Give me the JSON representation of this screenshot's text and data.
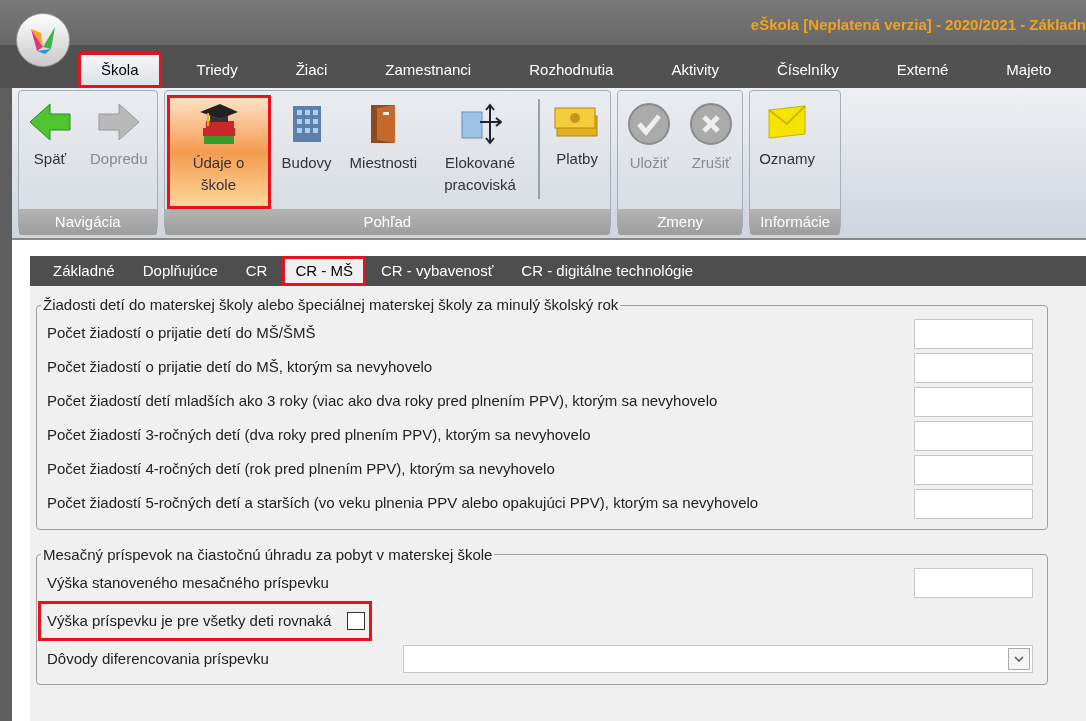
{
  "window": {
    "title": "eŠkola [Neplatená verzia] - 2020/2021 - Základn"
  },
  "menu_tabs": [
    {
      "label": "Škola",
      "selected": true,
      "highlighted": true
    },
    {
      "label": "Triedy",
      "selected": false,
      "highlighted": false
    },
    {
      "label": "Žiaci",
      "selected": false,
      "highlighted": false
    },
    {
      "label": "Zamestnanci",
      "selected": false,
      "highlighted": false
    },
    {
      "label": "Rozhodnutia",
      "selected": false,
      "highlighted": false
    },
    {
      "label": "Aktivity",
      "selected": false,
      "highlighted": false
    },
    {
      "label": "Číselníky",
      "selected": false,
      "highlighted": false
    },
    {
      "label": "Externé",
      "selected": false,
      "highlighted": false
    },
    {
      "label": "Majeto",
      "selected": false,
      "highlighted": false
    }
  ],
  "ribbon_groups": [
    {
      "label": "Navigácia",
      "buttons": [
        {
          "kind": "back",
          "label": "Späť",
          "disabled": false,
          "selected": false,
          "highlighted": false,
          "separator_before": false
        },
        {
          "kind": "forward",
          "label": "Dopredu",
          "disabled": true,
          "selected": false,
          "highlighted": false,
          "separator_before": false
        }
      ]
    },
    {
      "label": "Pohľad",
      "buttons": [
        {
          "kind": "school",
          "label": "Údaje o škole",
          "disabled": false,
          "selected": true,
          "highlighted": true,
          "separator_before": false
        },
        {
          "kind": "building",
          "label": "Budovy",
          "disabled": false,
          "selected": false,
          "highlighted": false,
          "separator_before": false
        },
        {
          "kind": "door",
          "label": "Miestnosti",
          "disabled": false,
          "selected": false,
          "highlighted": false,
          "separator_before": false
        },
        {
          "kind": "branch",
          "label": "Elokované pracoviská",
          "disabled": false,
          "selected": false,
          "highlighted": false,
          "separator_before": false
        },
        {
          "kind": "money",
          "label": "Platby",
          "disabled": false,
          "selected": false,
          "highlighted": false,
          "separator_before": true
        }
      ]
    },
    {
      "label": "Zmeny",
      "buttons": [
        {
          "kind": "save",
          "label": "Uložiť",
          "disabled": true,
          "selected": false,
          "highlighted": false,
          "separator_before": false
        },
        {
          "kind": "cancel",
          "label": "Zrušiť",
          "disabled": true,
          "selected": false,
          "highlighted": false,
          "separator_before": false
        }
      ]
    },
    {
      "label": "Informácie",
      "buttons": [
        {
          "kind": "mail",
          "label": "Oznamy",
          "disabled": false,
          "selected": false,
          "highlighted": false,
          "separator_before": false
        }
      ]
    }
  ],
  "content_tabs": [
    {
      "label": "Základné",
      "selected": false,
      "highlighted": false
    },
    {
      "label": "Doplňujúce",
      "selected": false,
      "highlighted": false
    },
    {
      "label": "CR",
      "selected": false,
      "highlighted": false
    },
    {
      "label": "CR - MŠ",
      "selected": true,
      "highlighted": true
    },
    {
      "label": "CR - vybavenosť",
      "selected": false,
      "highlighted": false
    },
    {
      "label": "CR - digitálne technológie",
      "selected": false,
      "highlighted": false
    }
  ],
  "sections": [
    {
      "legend": "Žiadosti detí do materskej školy alebo špeciálnej materskej školy za minulý školský rok",
      "rows": [
        {
          "kind": "number",
          "label": "Počet žiadostí o prijatie detí do MŠ/ŠMŠ",
          "highlighted": false
        },
        {
          "kind": "number",
          "label": "Počet žiadostí o prijatie detí do MŠ, ktorým sa nevyhovelo",
          "highlighted": false
        },
        {
          "kind": "number",
          "label": "Počet žiadostí detí mladších ako 3 roky (viac ako dva roky pred plnením PPV), ktorým sa nevyhovelo",
          "highlighted": false
        },
        {
          "kind": "number",
          "label": "Počet žiadostí 3-ročných detí (dva roky pred plnením PPV), ktorým sa nevyhovelo",
          "highlighted": false
        },
        {
          "kind": "number",
          "label": "Počet žiadostí 4-ročných detí (rok pred plnením PPV), ktorým sa nevyhovelo",
          "highlighted": false
        },
        {
          "kind": "number",
          "label": "Počet žiadostí 5-ročných detí a starších (vo veku plnenia PPV alebo opakujúci PPV), ktorým sa nevyhovelo",
          "highlighted": false
        }
      ]
    },
    {
      "legend": "Mesačný príspevok na čiastočnú úhradu za pobyt v materskej škole",
      "rows": [
        {
          "kind": "number",
          "label": "Výška stanoveného mesačného príspevku",
          "highlighted": false
        },
        {
          "kind": "checkbox",
          "label": "Výška príspevku je pre všetky deti rovnaká",
          "checked": false,
          "highlighted": true
        },
        {
          "kind": "dropdown",
          "label": "Dôvody diferencovania príspevku",
          "highlighted": false
        }
      ]
    }
  ]
}
